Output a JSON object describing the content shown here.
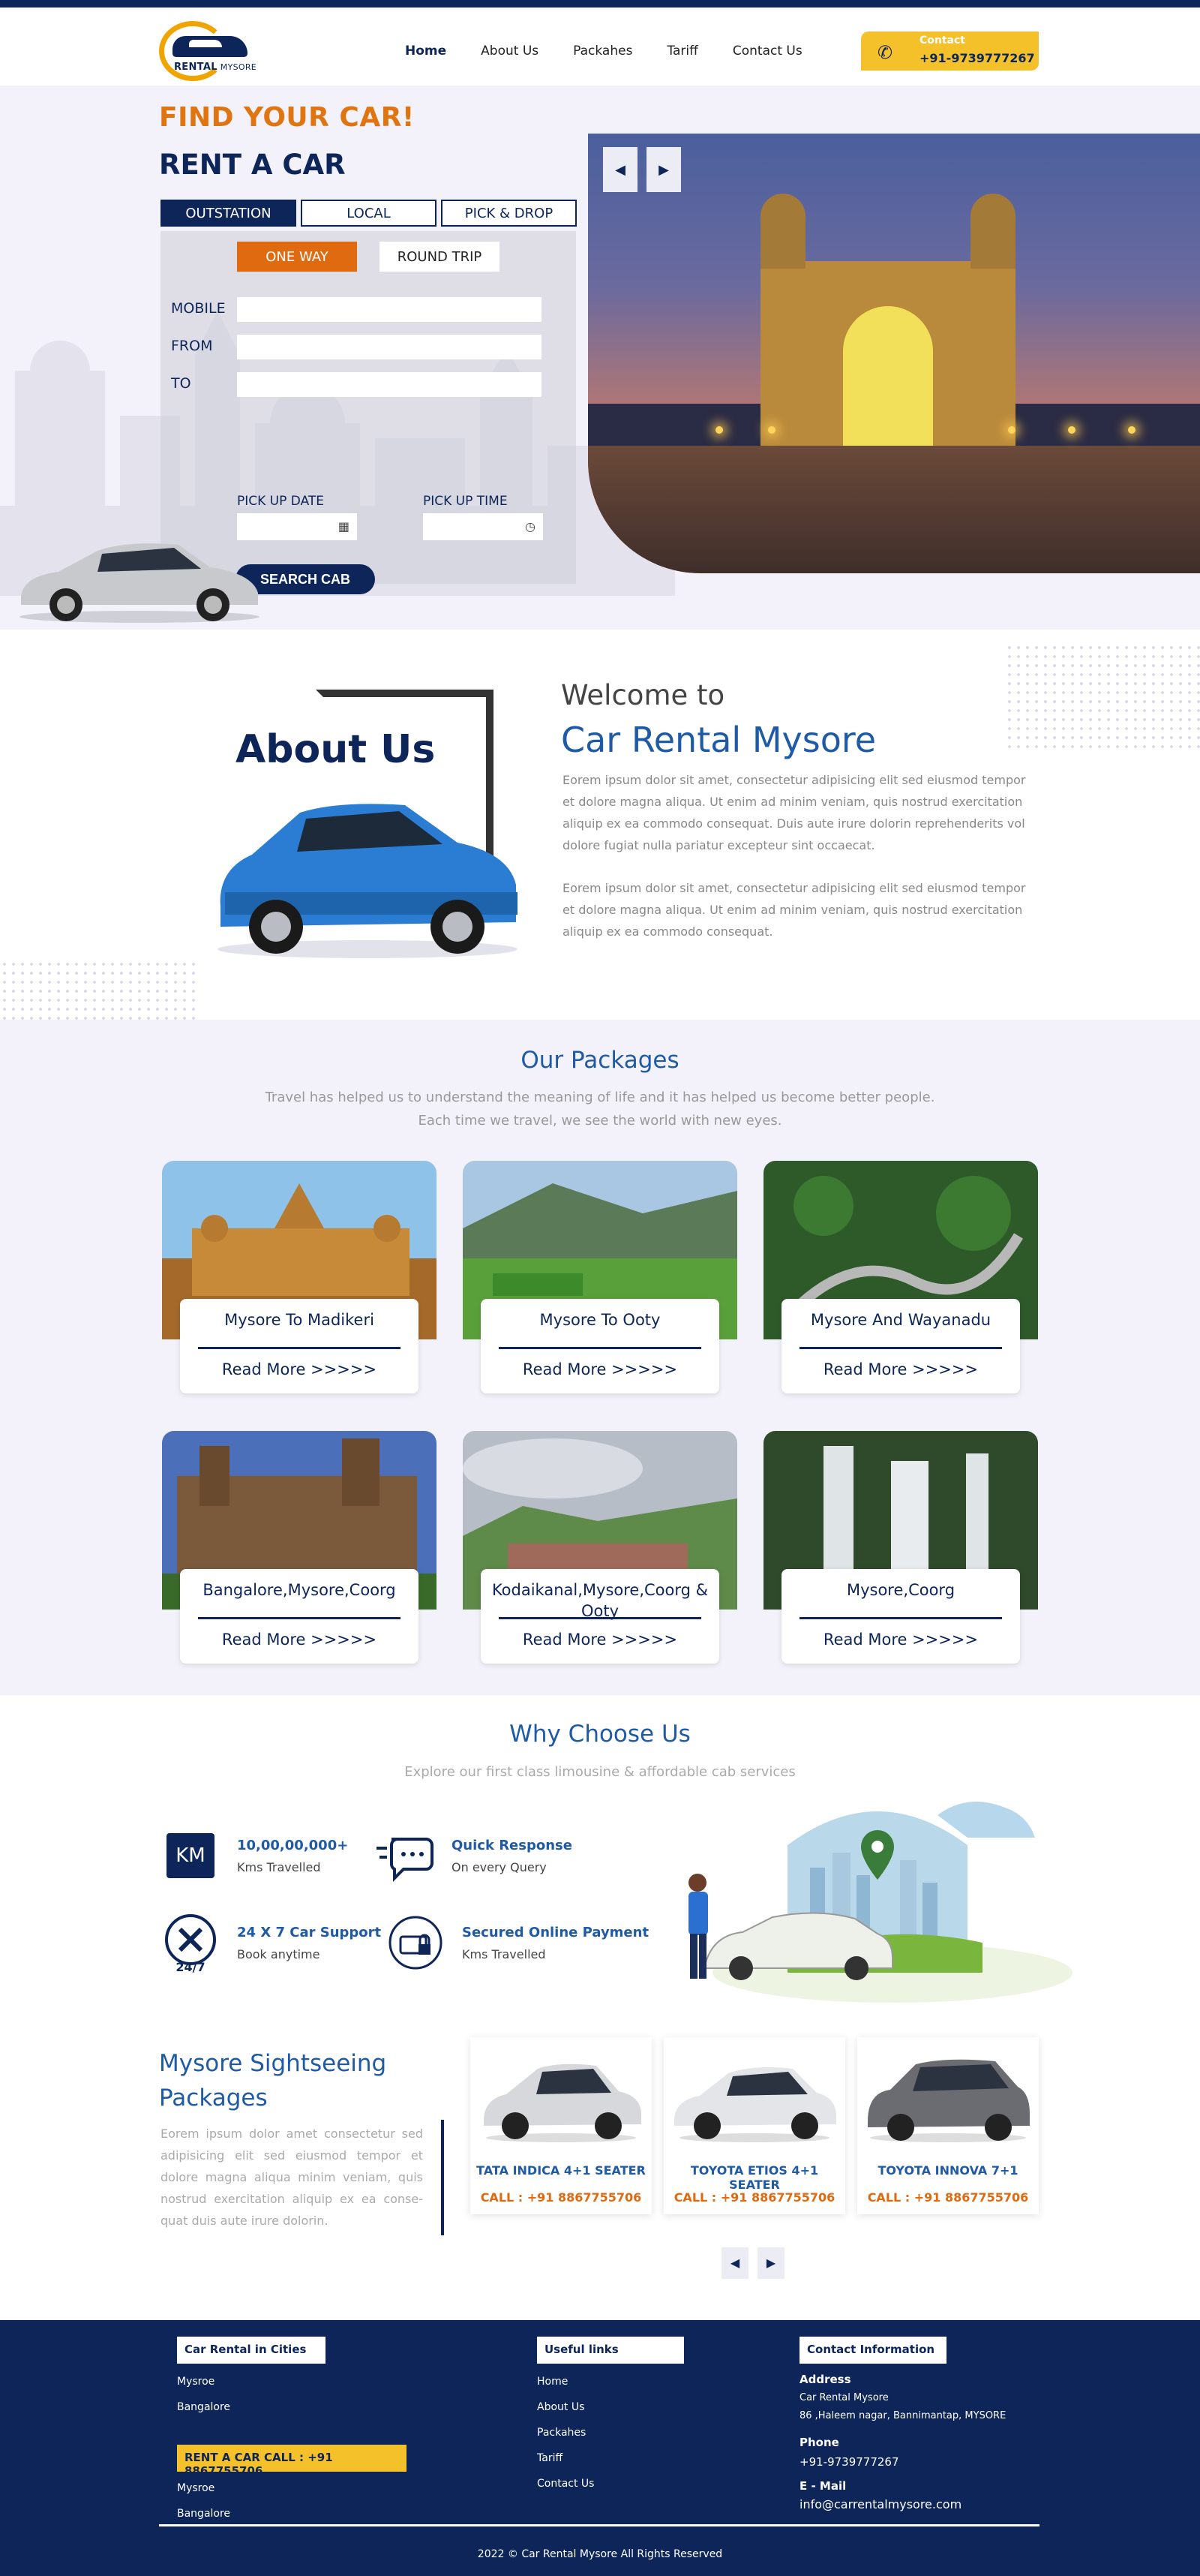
{
  "header": {
    "logo_brand": "RENTAL",
    "logo_sub": "MYSORE",
    "nav": [
      "Home",
      "About Us",
      "Packahes",
      "Tariff",
      "Contact Us"
    ],
    "contact_label": "Contact",
    "contact_number": "+91-9739777267"
  },
  "hero": {
    "eyebrow": "FIND YOUR CAR!",
    "title": "RENT A CAR",
    "tabs": [
      "OUTSTATION",
      "LOCAL",
      "PICK & DROP"
    ],
    "trip_types": [
      "ONE WAY",
      "ROUND TRIP"
    ],
    "fields": {
      "mobile": "MOBILE",
      "from": "FROM",
      "to": "TO",
      "pickup_date": "PICK UP DATE",
      "pickup_time": "PICK UP TIME"
    },
    "search_button": "SEARCH CAB"
  },
  "about": {
    "heading": "About Us",
    "welcome": "Welcome to",
    "brand": "Car Rental Mysore",
    "para1": "Eorem ipsum dolor sit amet, consectetur adipisicing elit sed eiusmod tempor et dolore magna aliqua. Ut enim ad minim veniam, quis nostrud exercitation aliquip ex ea commodo consequat. Duis aute irure dolorin reprehenderits vol dolore fugiat nulla pariatur excepteur sint occaecat.",
    "para2": "Eorem ipsum dolor sit amet, consectetur adipisicing elit sed eiusmod tempor et dolore magna aliqua. Ut enim ad minim veniam, quis nostrud exercitation aliquip ex ea commodo consequat."
  },
  "packages": {
    "heading": "Our Packages",
    "subtitle_line1": "Travel has helped us to understand the meaning of life and it has helped us become better people.",
    "subtitle_line2": "Each time we travel, we see the world with new eyes.",
    "read_more": "Read More >>>>>",
    "items": [
      {
        "title": "Mysore To Madikeri"
      },
      {
        "title": "Mysore To Ooty"
      },
      {
        "title": "Mysore And Wayanadu"
      },
      {
        "title": "Bangalore,Mysore,Coorg"
      },
      {
        "title": "Kodaikanal,Mysore,Coorg & Ooty"
      },
      {
        "title": "Mysore,Coorg"
      }
    ]
  },
  "why": {
    "heading": "Why Choose Us",
    "subtitle": "Explore our first class limousine & affordable cab services",
    "km_badge": "KM",
    "support_badge": "24/7",
    "features": [
      {
        "title": "10,00,00,000+",
        "sub": "Kms Travelled"
      },
      {
        "title": "Quick Response",
        "sub": "On every Query"
      },
      {
        "title": "24 X 7 Car Support",
        "sub": "Book anytime"
      },
      {
        "title": "Secured Online Payment",
        "sub": "Kms Travelled"
      }
    ]
  },
  "sightseeing": {
    "heading_line1": "Mysore Sightseeing",
    "heading_line2": "Packages",
    "para": "Eorem ipsum dolor amet consectetur sed adipisicing elit sed eiusmod tempor et dolore magna aliqua minim veniam, quis nostrud exercitation aliquip ex ea conse- quat duis aute irure dolorin.",
    "cars": [
      {
        "name": "TATA INDICA 4+1 SEATER",
        "call": "CALL : +91 8867755706"
      },
      {
        "name": "TOYOTA ETIOS 4+1 SEATER",
        "call": "CALL : +91 8867755706"
      },
      {
        "name": "TOYOTA INNOVA 7+1",
        "call": "CALL : +91 8867755706"
      }
    ]
  },
  "footer": {
    "cities_title": "Car Rental in Cities",
    "cities": [
      "Mysroe",
      "Bangalore"
    ],
    "call_bar": "RENT A CAR CALL : +91 8867755706",
    "cities2": [
      "Mysroe",
      "Bangalore"
    ],
    "links_title": "Useful links",
    "links": [
      "Home",
      "About Us",
      "Packahes",
      "Tariff",
      "Contact Us"
    ],
    "contact_title": "Contact Information",
    "address_h": "Address",
    "address_l1": "Car Rental Mysore",
    "address_l2": "86 ,Haleem nagar, Bannimantap, MYSORE",
    "phone_h": "Phone",
    "phone": "+91-9739777267",
    "email_h": "E - Mail",
    "email": "info@carrentalmysore.com",
    "copyright": "2022 © Car Rental Mysore All Rights Reserved"
  },
  "colors": {
    "navy": "#0d2558",
    "blue": "#1f5aa6",
    "orange": "#e06a10",
    "yellow": "#f5c12b"
  }
}
